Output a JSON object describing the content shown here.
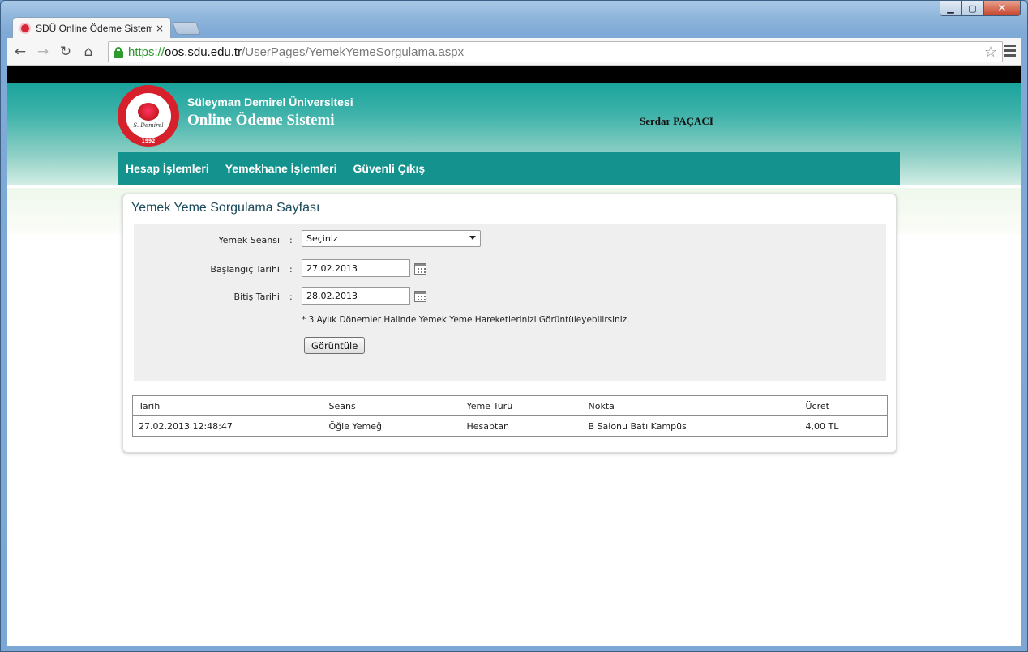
{
  "browser": {
    "tab_title": "SDÜ Online Ödeme Sistem",
    "tab_close": "×",
    "url_scheme": "https://",
    "url_host": "oos.sdu.edu.tr",
    "url_path": "/UserPages/YemekYemeSorgulama.aspx",
    "window_controls": {
      "minimize": "▁",
      "maximize": "▢",
      "close": "✕"
    }
  },
  "header": {
    "university": "Süleyman Demirel Üniversitesi",
    "system": "Online Ödeme Sistemi",
    "user": "Serdar PAÇACI",
    "logo_signature": "S. Demirel",
    "logo_year": "1992"
  },
  "nav": {
    "items": [
      "Hesap İşlemleri",
      "Yemekhane İşlemleri",
      "Güvenli Çıkış"
    ]
  },
  "panel": {
    "title": "Yemek Yeme Sorgulama Sayfası"
  },
  "form": {
    "session_label": "Yemek Seansı",
    "session_value": "Seçiniz",
    "start_label": "Başlangıç Tarihi",
    "start_value": "27.02.2013",
    "end_label": "Bitiş Tarihi",
    "end_value": "28.02.2013",
    "colon": ":",
    "note": "* 3 Aylık Dönemler Halinde Yemek Yeme Hareketlerinizi Görüntüleyebilirsiniz.",
    "button": "Görüntüle"
  },
  "table": {
    "headers": [
      "Tarih",
      "Seans",
      "Yeme Türü",
      "Nokta",
      "Ücret"
    ],
    "rows": [
      [
        "27.02.2013 12:48:47",
        "Öğle Yemeği",
        "Hesaptan",
        "B Salonu Batı Kampüs",
        "4,00 TL"
      ]
    ]
  }
}
